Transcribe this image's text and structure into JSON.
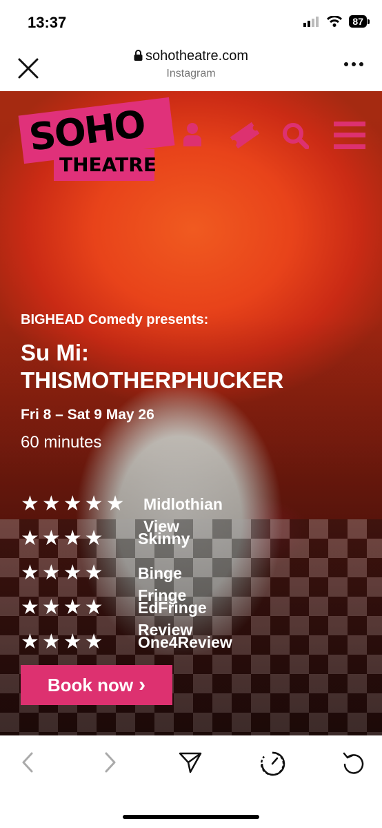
{
  "status_bar": {
    "time": "13:37",
    "battery": "87"
  },
  "browser": {
    "domain": "sohotheatre.com",
    "source": "Instagram"
  },
  "logo": {
    "line1": "SOHO",
    "line2": "THEATRE"
  },
  "colors": {
    "brand_pink": "#dd3170",
    "hero_orange": "#e8431a"
  },
  "show": {
    "presenter": "BIGHEAD Comedy presents:",
    "title_line1": "Su Mi:",
    "title_line2": "THISMOTHERPHUCKER",
    "dates": "Fri 8 – Sat 9 May 26",
    "duration": "60 minutes"
  },
  "reviews": [
    {
      "stars": "★★★★★",
      "source": "Midlothian View"
    },
    {
      "stars": "★★★★",
      "source": "Skinny"
    },
    {
      "stars": "★★★★",
      "source": "Binge Fringe"
    },
    {
      "stars": "★★★★",
      "source": "EdFringe Review"
    },
    {
      "stars": "★★★★",
      "source": "One4Review"
    }
  ],
  "cta": {
    "label": "Book now",
    "chevron": "›"
  },
  "icons": [
    "close-icon",
    "lock-icon",
    "more-icon",
    "user-icon",
    "ticket-icon",
    "search-icon",
    "menu-icon",
    "back-icon",
    "forward-icon",
    "share-icon",
    "speed-icon",
    "reload-icon"
  ]
}
